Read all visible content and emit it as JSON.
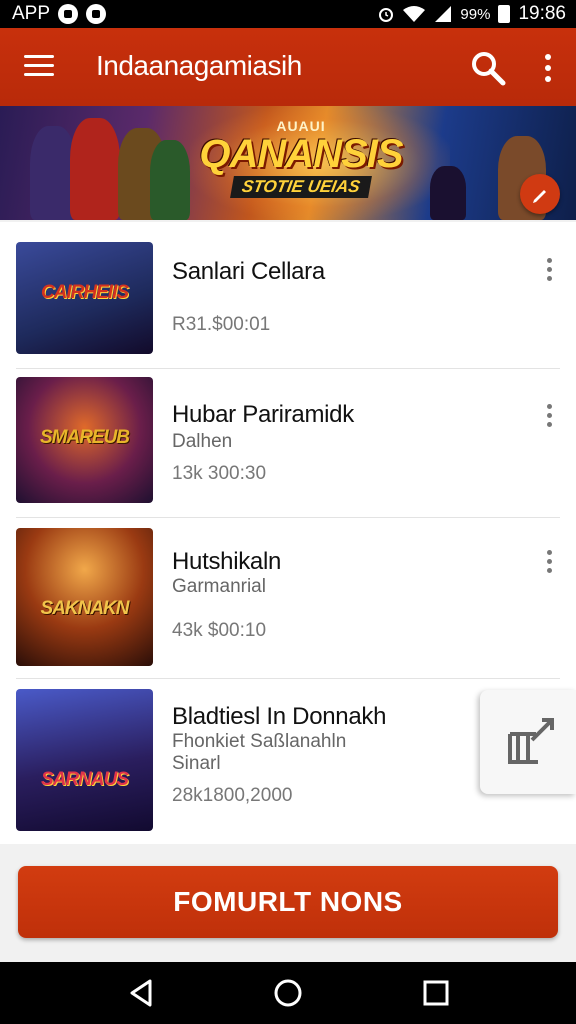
{
  "status_bar": {
    "app_label": "APP",
    "battery_text": "99%",
    "time": "19:86"
  },
  "app_bar": {
    "title": "Indaanagamiasih"
  },
  "banner": {
    "small_text": "AUAUI",
    "title": "QANANSIS",
    "subtitle": "STOTIE UEIAS"
  },
  "items": [
    {
      "title": "Sanlari Cellara",
      "subtitle": "",
      "meta": "R31.$00:01",
      "thumb_text": "CAIRHEIIS",
      "thumb_bg": "#1e2a5c",
      "thumb_accent": "#d3321f"
    },
    {
      "title": "Hubar Pariramidk",
      "subtitle": "Dalhen",
      "meta": "13k 300:30",
      "thumb_text": "SMAREUB",
      "thumb_bg": "#3a1e3a",
      "thumb_accent": "#e8b52a"
    },
    {
      "title": "Hutshikaln",
      "subtitle": "Garmanrial",
      "meta": "43k $00:10",
      "thumb_text": "SAKNAKN",
      "thumb_bg": "#6a2a12",
      "thumb_accent": "#f1c44a"
    },
    {
      "title": "Bladtiesl In Donnakh",
      "subtitle": "Fhonkiet Saßlanahln",
      "subtitle2": "Sinarl",
      "meta": "28k1800,2000",
      "thumb_text": "SARNAUS",
      "thumb_bg": "#2a1e5e",
      "thumb_accent": "#e0344a"
    }
  ],
  "primary_button": {
    "label": "FOMURLT NONS"
  },
  "colors": {
    "primary": "#c8300c",
    "list_background": "#ffffff",
    "page_background": "#f1f1f1"
  },
  "icons": [
    "menu-icon",
    "search-icon",
    "overflow-menu-icon",
    "edit-icon",
    "share-icon",
    "back-icon",
    "home-icon",
    "recents-icon"
  ]
}
